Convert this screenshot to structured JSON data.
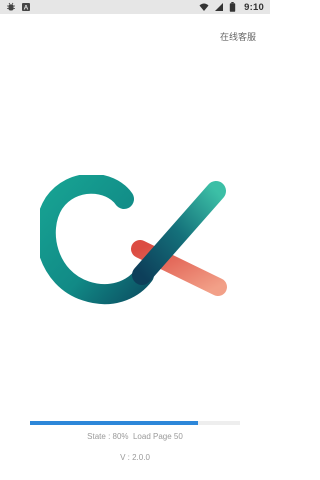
{
  "status_bar": {
    "left_icons": [
      "bug-icon",
      "text-icon"
    ],
    "right_icons": [
      "wifi-icon",
      "signal-icon",
      "battery-icon"
    ],
    "time": "9:10"
  },
  "header": {
    "support_label": "在线客服"
  },
  "logo": {
    "name": "ck-logo-icon",
    "colors": {
      "teal_dark": "#0f5f6b",
      "teal": "#16918a",
      "teal_light": "#39b3a1",
      "coral": "#e6584c",
      "coral_light": "#f19a7f"
    }
  },
  "loader": {
    "progress": 0.8,
    "state_text": "State : 80%  Load Page 50",
    "version_text": "V : 2.0.0",
    "accent": "#2d87d9"
  }
}
